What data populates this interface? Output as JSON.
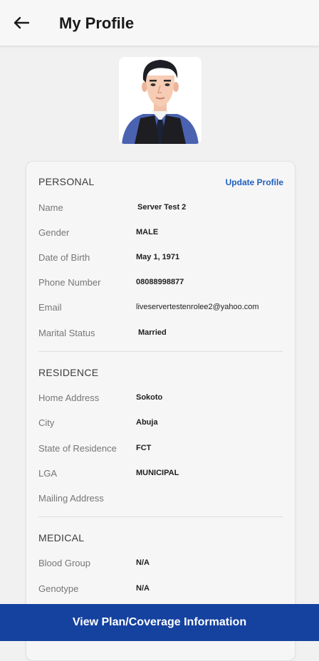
{
  "header": {
    "title": "My Profile",
    "back_icon": "arrow-left-icon"
  },
  "profile": {
    "avatar_icon": "person-avatar-illustration"
  },
  "personal": {
    "section_title": "PERSONAL",
    "update_link": "Update Profile",
    "fields": [
      {
        "label": "Name",
        "value": "Server Test 2"
      },
      {
        "label": "Gender",
        "value": "MALE"
      },
      {
        "label": "Date of Birth",
        "value": "May 1, 1971"
      },
      {
        "label": "Phone Number",
        "value": "08088998877"
      },
      {
        "label": "Email",
        "value": "liveservertestenrolee2@yahoo.com"
      },
      {
        "label": "Marital Status",
        "value": "Married"
      }
    ]
  },
  "residence": {
    "section_title": "RESIDENCE",
    "fields": [
      {
        "label": "Home Address",
        "value": "Sokoto"
      },
      {
        "label": "City",
        "value": "Abuja"
      },
      {
        "label": "State of Residence",
        "value": "FCT"
      },
      {
        "label": "LGA",
        "value": "MUNICIPAL"
      },
      {
        "label": "Mailing Address",
        "value": ""
      }
    ]
  },
  "medical": {
    "section_title": "MEDICAL",
    "fields": [
      {
        "label": "Blood Group",
        "value": "N/A"
      },
      {
        "label": "Genotype",
        "value": "N/A"
      }
    ]
  },
  "footer": {
    "button_label": "View Plan/Coverage Information"
  },
  "colors": {
    "primary": "#15429f",
    "link": "#1f5fbf"
  }
}
